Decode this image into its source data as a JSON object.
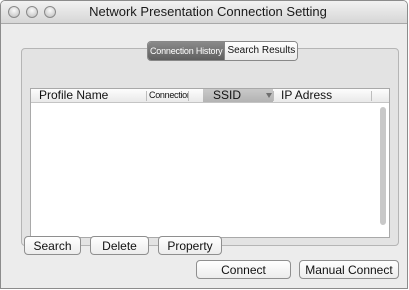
{
  "window": {
    "title": "Network Presentation Connection Setting"
  },
  "tabs": {
    "items": [
      {
        "label": "Connection History",
        "active": true
      },
      {
        "label": "Search Results",
        "active": false
      }
    ]
  },
  "table": {
    "columns": [
      "Profile Name",
      "Connection",
      "SSID",
      "IP Adress"
    ],
    "sorted_column": "SSID",
    "rows": []
  },
  "buttons": {
    "search": "Search",
    "delete": "Delete",
    "property": "Property",
    "connect": "Connect",
    "manual_connect": "Manual Connect"
  },
  "colors": {
    "active_tab": "#6f6f6f",
    "window_bg": "#ececec"
  }
}
